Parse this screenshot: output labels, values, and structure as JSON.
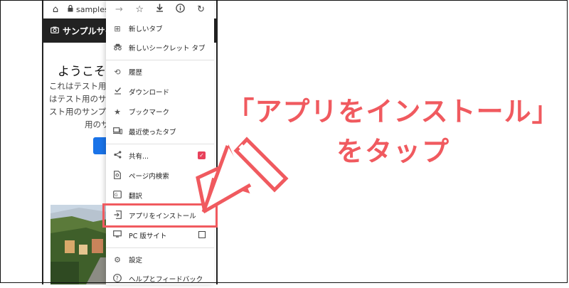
{
  "browser": {
    "url_partial": "samplesi",
    "icons": [
      "home-icon",
      "lock-icon",
      "forward-icon",
      "star-icon",
      "download-icon",
      "info-icon",
      "reload-icon"
    ]
  },
  "site": {
    "header_title": "サンプルサイ",
    "welcome": "ようこそ、",
    "body_lines": [
      "これはテスト用",
      "はテスト用のサ",
      "スト用のサンプ",
      "用のサ"
    ],
    "button_label": "ボ"
  },
  "menu": {
    "items": [
      {
        "label": "新しいタブ",
        "icon": "new-tab-icon"
      },
      {
        "label": "新しいシークレット タブ",
        "icon": "incognito-icon"
      },
      {
        "label": "履歴",
        "icon": "history-icon"
      },
      {
        "label": "ダウンロード",
        "icon": "downloads-icon"
      },
      {
        "label": "ブックマーク",
        "icon": "bookmark-star-icon"
      },
      {
        "label": "最近使ったタブ",
        "icon": "recent-tabs-icon"
      },
      {
        "label": "共有...",
        "icon": "share-icon"
      },
      {
        "label": "ページ内検索",
        "icon": "find-in-page-icon"
      },
      {
        "label": "翻訳",
        "icon": "translate-icon"
      },
      {
        "label": "アプリをインストール",
        "icon": "install-app-icon"
      },
      {
        "label": "PC 版サイト",
        "icon": "desktop-site-icon"
      },
      {
        "label": "設定",
        "icon": "settings-gear-icon"
      },
      {
        "label": "ヘルプとフィードバック",
        "icon": "help-icon"
      }
    ]
  },
  "callout": {
    "line1": "「アプリをインストール」",
    "line2": "をタップ",
    "color": "#f05a5f"
  }
}
